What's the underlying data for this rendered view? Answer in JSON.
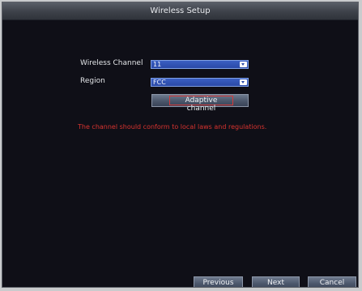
{
  "window": {
    "title": "Wireless Setup"
  },
  "form": {
    "channel_label": "Wireless Channel",
    "channel_value": "11",
    "region_label": "Region",
    "region_value": "FCC",
    "adaptive_label": "Adaptive channel"
  },
  "warning": "The channel should conform to local laws and regulations.",
  "footer": {
    "previous": "Previous",
    "next": "Next",
    "cancel": "Cancel"
  },
  "colors": {
    "background": "#0f0f17",
    "select": "#2a49a7",
    "warning": "#d8332f",
    "highlight": "#d43a3a"
  }
}
